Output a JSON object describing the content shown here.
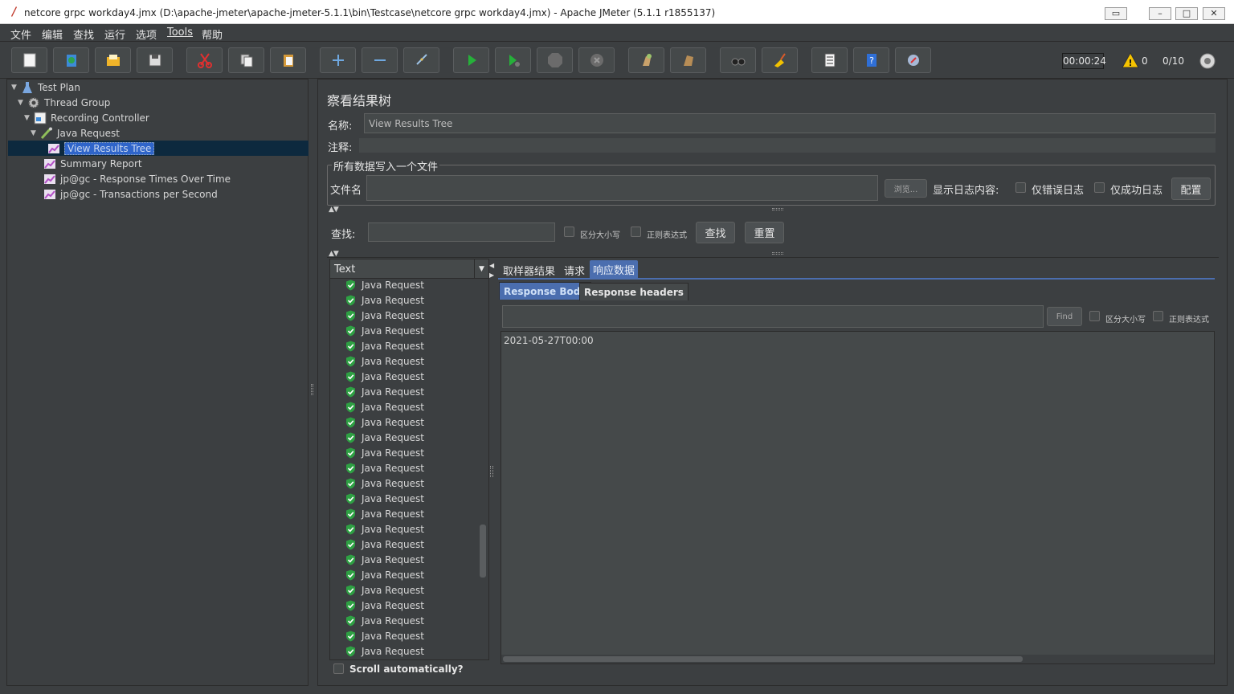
{
  "window": {
    "title": "netcore grpc workday4.jmx (D:\\apache-jmeter\\apache-jmeter-5.1.1\\bin\\Testcase\\netcore grpc workday4.jmx) - Apache JMeter (5.1.1 r1855137)"
  },
  "menu": [
    "文件",
    "编辑",
    "查找",
    "运行",
    "选项",
    "Tools",
    "帮助"
  ],
  "toolbar": {
    "buttons": [
      "new-icon",
      "templates-icon",
      "open-icon",
      "save-icon",
      "cut-icon",
      "copy-icon",
      "paste-icon",
      "expand-icon",
      "collapse-icon",
      "toggle-icon",
      "start-icon",
      "start-no-pause-icon",
      "stop-icon",
      "shutdown-icon",
      "clear-icon",
      "clear-all-icon",
      "search-icon",
      "reset-search-icon",
      "function-helper-icon",
      "help-icon",
      "remote-icon"
    ],
    "timer": "00:00:24",
    "warning_count": "0",
    "threads": "0/10"
  },
  "tree": {
    "items": [
      {
        "label": "Test Plan",
        "icon": "test-plan-icon"
      },
      {
        "label": "Thread Group",
        "icon": "thread-group-icon"
      },
      {
        "label": "Recording Controller",
        "icon": "recording-controller-icon"
      },
      {
        "label": "Java Request",
        "icon": "java-request-icon"
      },
      {
        "label": "View Results Tree",
        "icon": "listener-icon"
      },
      {
        "label": "Summary Report",
        "icon": "listener-icon"
      },
      {
        "label": "jp@gc - Response Times Over Time",
        "icon": "listener-icon"
      },
      {
        "label": "jp@gc - Transactions per Second",
        "icon": "listener-icon"
      }
    ]
  },
  "panel": {
    "title": "察看结果树",
    "name_label": "名称:",
    "name_value": "View Results Tree",
    "comment_label": "注释:",
    "file_section_title": "所有数据写入一个文件",
    "filename_label": "文件名",
    "browse_label": "浏览...",
    "log_label": "显示日志内容:",
    "errors_only_label": "仅错误日志",
    "success_only_label": "仅成功日志",
    "configure_label": "配置",
    "search_label": "查找:",
    "case_sensitive_label": "区分大小写",
    "regex_label": "正则表达式",
    "search_button": "查找",
    "reset_button": "重置"
  },
  "results": {
    "renderer": "Text",
    "items": [
      "Java Request",
      "Java Request",
      "Java Request",
      "Java Request",
      "Java Request",
      "Java Request",
      "Java Request",
      "Java Request",
      "Java Request",
      "Java Request",
      "Java Request",
      "Java Request",
      "Java Request",
      "Java Request",
      "Java Request",
      "Java Request",
      "Java Request",
      "Java Request",
      "Java Request",
      "Java Request",
      "Java Request",
      "Java Request",
      "Java Request",
      "Java Request",
      "Java Request"
    ],
    "scroll_auto_label": "Scroll automatically?"
  },
  "tabs": [
    "取样器结果",
    "请求",
    "响应数据"
  ],
  "subtabs": [
    "Response Body",
    "Response headers"
  ],
  "response": {
    "find_label": "Find",
    "case_sensitive_label": "区分大小写",
    "regex_label": "正则表达式",
    "body": "2021-05-27T00:00"
  }
}
